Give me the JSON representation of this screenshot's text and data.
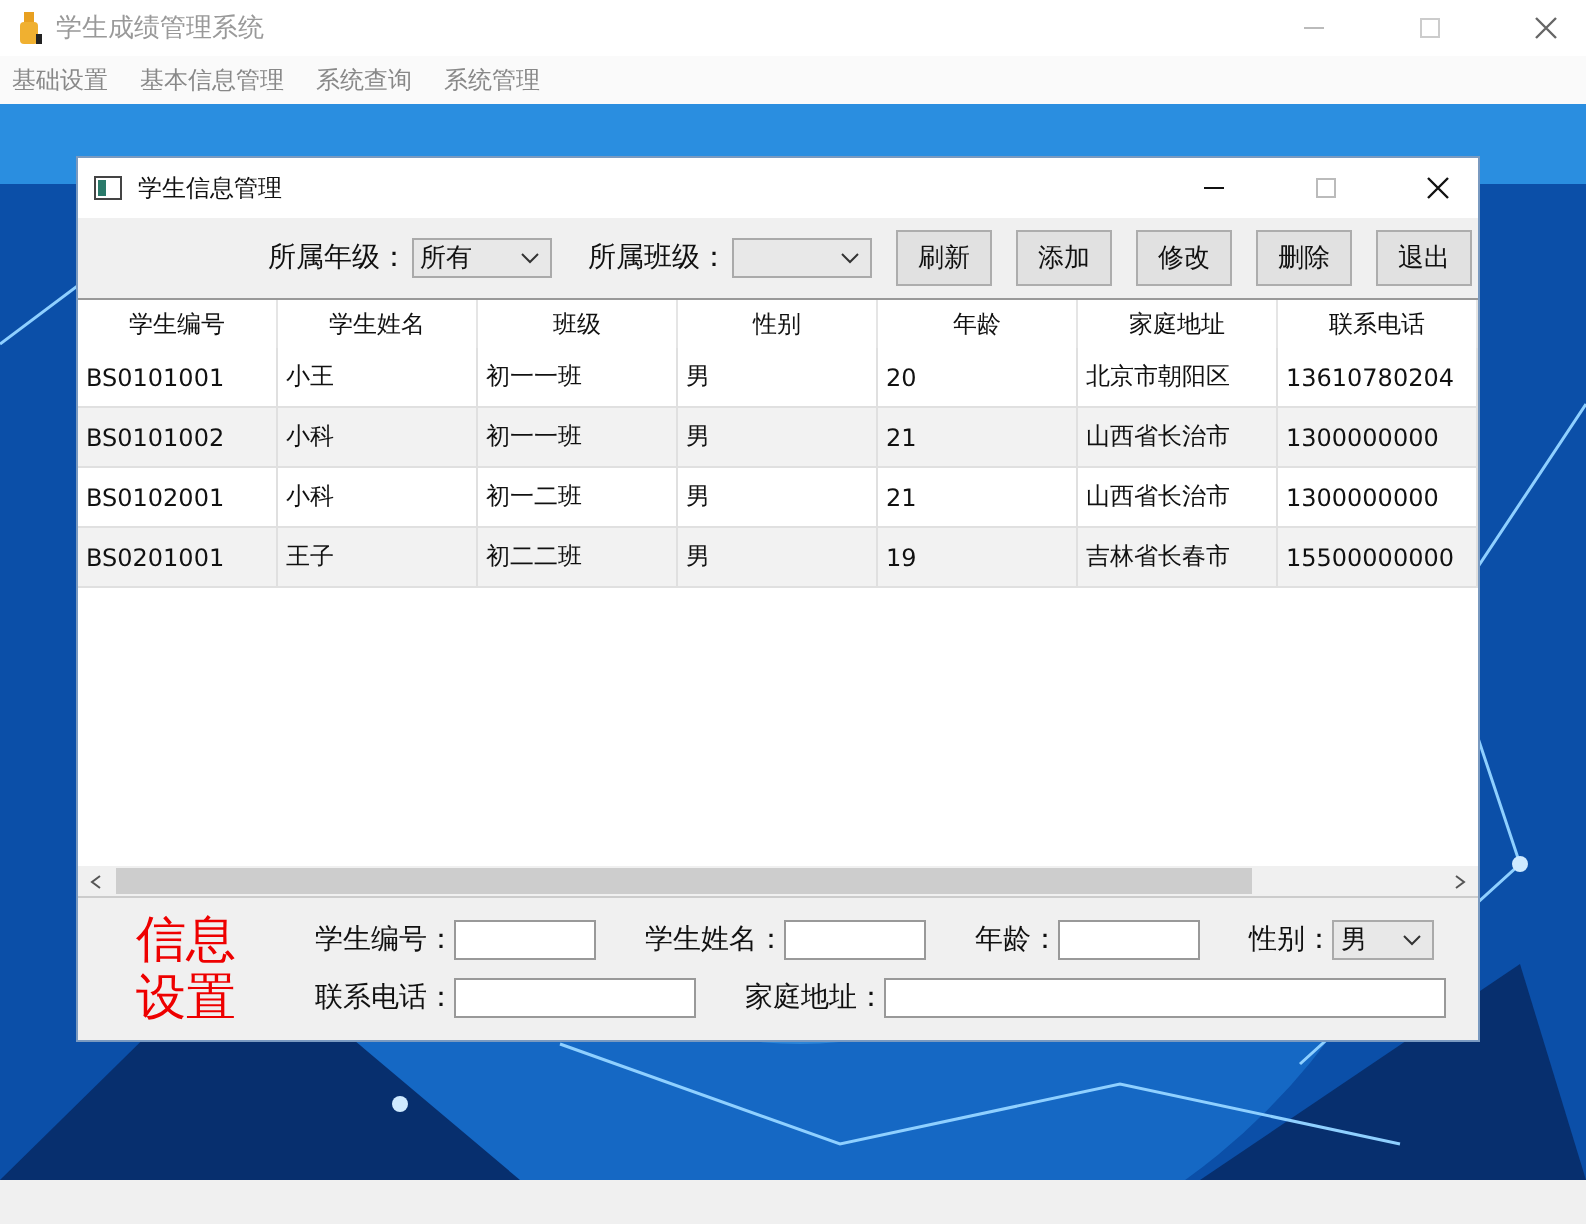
{
  "window": {
    "title": "学生成绩管理系统"
  },
  "menu": [
    "基础设置",
    "基本信息管理",
    "系统查询",
    "系统管理"
  ],
  "dialog": {
    "title": "学生信息管理"
  },
  "filters": [
    {
      "label": "所属年级：",
      "value": "所有"
    },
    {
      "label": "所属班级："
    }
  ],
  "buttons": [
    "刷新",
    "添加",
    "修改",
    "删除",
    "退出"
  ],
  "table": {
    "columns": [
      "学生编号",
      "学生姓名",
      "班级",
      "性别",
      "年龄",
      "家庭地址",
      "联系电话"
    ],
    "rows": [
      [
        "BS0101001",
        "小王",
        "初一一班",
        "男",
        "20",
        "北京市朝阳区",
        "13610780204"
      ],
      [
        "BS0101002",
        "小科",
        "初一一班",
        "男",
        "21",
        "山西省长治市",
        "1300000000"
      ],
      [
        "BS0102001",
        "小科",
        "初一二班",
        "男",
        "21",
        "山西省长治市",
        "1300000000"
      ],
      [
        "BS0201001",
        "王子",
        "初二二班",
        "男",
        "19",
        "吉林省长春市",
        "15500000000"
      ]
    ]
  },
  "form": {
    "heading": "信息设置",
    "rows": [
      [
        {
          "kind": "input",
          "label": "学生编号："
        },
        {
          "kind": "input",
          "label": "学生姓名："
        },
        {
          "kind": "input",
          "label": "年龄："
        },
        {
          "kind": "select",
          "label": "性别：",
          "value": "男"
        }
      ],
      [
        {
          "kind": "input",
          "label": "联系电话："
        },
        {
          "kind": "input",
          "label": "家庭地址："
        }
      ]
    ]
  }
}
